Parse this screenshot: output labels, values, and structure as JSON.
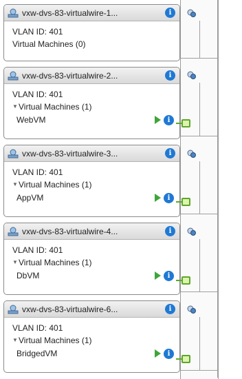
{
  "port_groups": [
    {
      "title": "vxw-dvs-83-virtualwire-1...",
      "vlan": "VLAN ID: 401",
      "vms_label": "Virtual Machines (0)",
      "vms": []
    },
    {
      "title": "vxw-dvs-83-virtualwire-2...",
      "vlan": "VLAN ID: 401",
      "vms_label": "Virtual Machines (1)",
      "vms": [
        "WebVM"
      ]
    },
    {
      "title": "vxw-dvs-83-virtualwire-3...",
      "vlan": "VLAN ID: 401",
      "vms_label": "Virtual Machines (1)",
      "vms": [
        "AppVM"
      ]
    },
    {
      "title": "vxw-dvs-83-virtualwire-4...",
      "vlan": "VLAN ID: 401",
      "vms_label": "Virtual Machines (1)",
      "vms": [
        "DbVM"
      ]
    },
    {
      "title": "vxw-dvs-83-virtualwire-6...",
      "vlan": "VLAN ID: 401",
      "vms_label": "Virtual Machines (1)",
      "vms": [
        "BridgedVM"
      ]
    }
  ],
  "icons": {
    "portgroup": "network-portgroup-icon",
    "info": "info-icon",
    "power": "power-on-icon",
    "uplink": "uplink-port-icon",
    "vm_port": "vm-port-icon",
    "expand": "expand-triangle-icon"
  },
  "info_glyph": "i",
  "expand_glyph": "▼",
  "colors": {
    "info_blue": "#1f79d4",
    "power_green": "#3fa53a",
    "port_green": "#5ca829",
    "header_gray": "#d9d9d9"
  }
}
